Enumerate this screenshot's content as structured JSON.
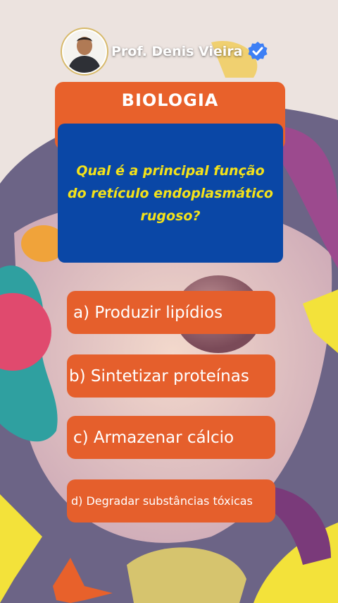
{
  "header": {
    "creator_name": "Prof. Denis Vieira",
    "verified_icon": "verified-check-icon",
    "avatar_icon": "avatar-photo"
  },
  "card": {
    "subject": "BIOLOGIA",
    "question": "Qual é a principal função do retículo endoplasmático rugoso?"
  },
  "options": [
    {
      "label": "a) Produzir lipídios"
    },
    {
      "label": "b) Sintetizar proteínas"
    },
    {
      "label": "c) Armazenar cálcio"
    },
    {
      "label": "d) Degradar substâncias tóxicas"
    }
  ],
  "colors": {
    "subject_bg": "#e8612b",
    "question_bg": "#0a47a6",
    "question_text": "#f4e21a",
    "option_bg": "#e55f2c",
    "verified_badge": "#3d7ff5"
  }
}
